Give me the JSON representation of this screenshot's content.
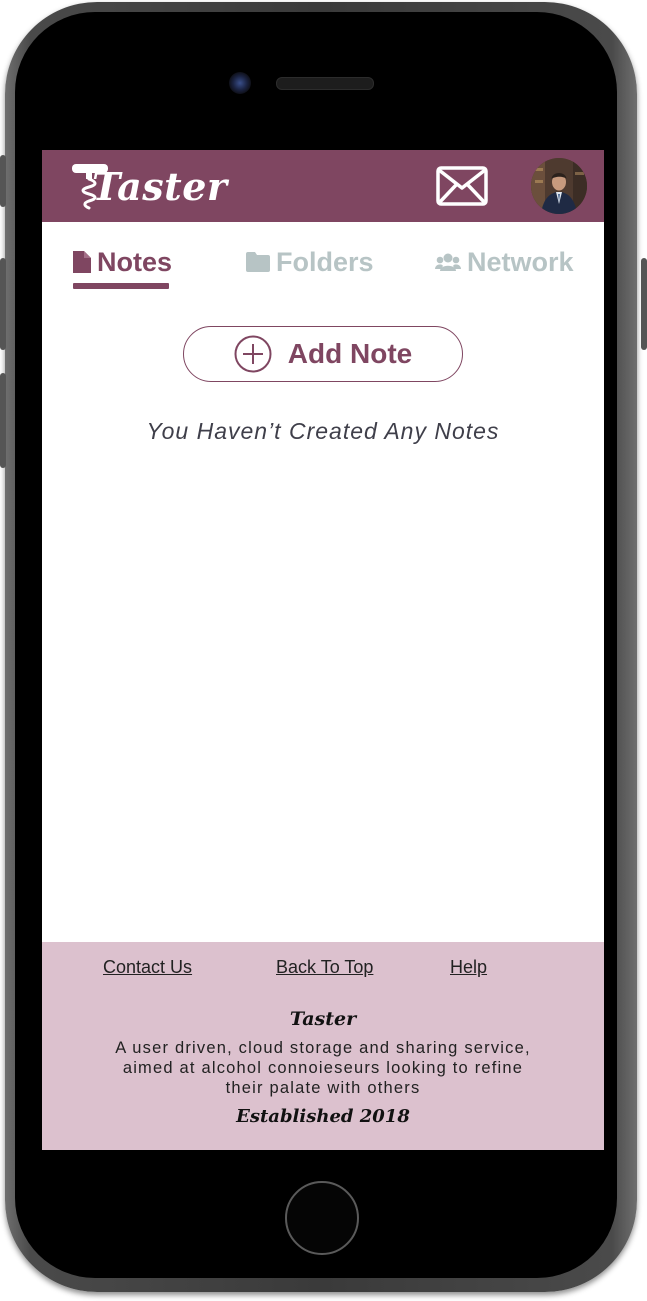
{
  "app": {
    "brand": "Taster",
    "accent_color": "#7f4661",
    "footer_color": "#dcc1ce",
    "inactive_tab_color": "#b7c4c5"
  },
  "header": {
    "logo_text": "Taster",
    "logo_icon": "corkscrew-icon",
    "mail_icon": "envelope-icon",
    "avatar_icon": "user-avatar"
  },
  "tabs": [
    {
      "label": "Notes",
      "icon": "document-icon",
      "active": true
    },
    {
      "label": "Folders",
      "icon": "folder-icon",
      "active": false
    },
    {
      "label": "Network",
      "icon": "users-icon",
      "active": false
    }
  ],
  "main": {
    "add_note_label": "Add Note",
    "add_note_icon": "plus-circle-icon",
    "empty_message": "You Haven’t Created Any Notes"
  },
  "footer": {
    "links": [
      "Contact Us",
      "Back To Top",
      "Help"
    ],
    "brand": "Taster",
    "description": "A user driven, cloud storage and sharing service, aimed at alcohol connoieseurs looking to refine their palate with others",
    "established": "Established 2018"
  }
}
